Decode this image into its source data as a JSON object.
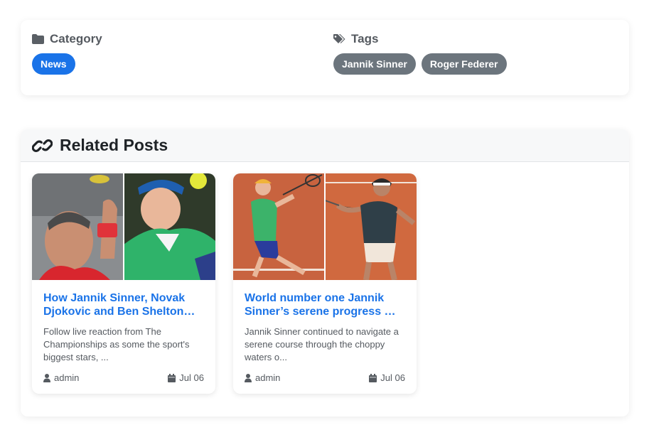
{
  "meta": {
    "category_heading": "Category",
    "category": "News",
    "tags_heading": "Tags",
    "tags": [
      "Jannik Sinner",
      "Roger Federer"
    ]
  },
  "related": {
    "heading": "Related Posts",
    "posts": [
      {
        "title": "How Jannik Sinner, Novak Djokovic and Ben Shelton…",
        "excerpt": "Follow live reaction from The Championships as some the sport's biggest stars, ...",
        "author": "admin",
        "date": "Jul 06"
      },
      {
        "title": "World number one Jannik Sinner’s serene progress …",
        "excerpt": "Jannik Sinner continued to navigate a serene course through the choppy waters o...",
        "author": "admin",
        "date": "Jul 06"
      }
    ]
  },
  "colors": {
    "accent": "#1a73e8",
    "tag_bg": "#6c757d",
    "clay": "#c8633f"
  }
}
